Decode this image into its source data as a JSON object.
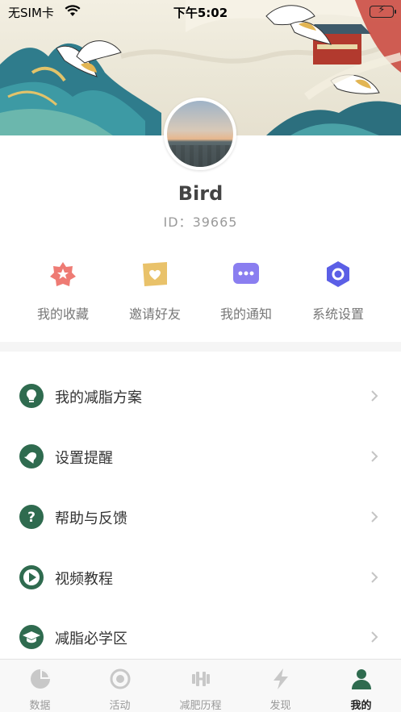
{
  "status_bar": {
    "carrier": "无SIM卡",
    "time": "下午5:02",
    "battery_icon": "battery-charging-icon",
    "wifi_icon": "wifi-icon"
  },
  "profile": {
    "name": "Bird",
    "id_label": "ID：",
    "id_value": "39665"
  },
  "quick_actions": [
    {
      "label": "我的收藏",
      "icon": "star-badge-icon",
      "color": "#ee7b74"
    },
    {
      "label": "邀请好友",
      "icon": "heart-note-icon",
      "color": "#e9c26a"
    },
    {
      "label": "我的通知",
      "icon": "message-dots-icon",
      "color": "#8a7ef0"
    },
    {
      "label": "系统设置",
      "icon": "hexagon-settings-icon",
      "color": "#5b5fe6"
    }
  ],
  "menu": [
    {
      "label": "我的减脂方案",
      "icon": "lightbulb-icon"
    },
    {
      "label": "设置提醒",
      "icon": "bell-icon"
    },
    {
      "label": "帮助与反馈",
      "icon": "help-icon"
    },
    {
      "label": "视频教程",
      "icon": "play-icon"
    },
    {
      "label": "减脂必学区",
      "icon": "graduation-cap-icon"
    }
  ],
  "tabs": [
    {
      "label": "数据",
      "icon": "pie-chart-icon",
      "active": false
    },
    {
      "label": "活动",
      "icon": "circle-target-icon",
      "active": false
    },
    {
      "label": "减肥历程",
      "icon": "dumbbell-icon",
      "active": false
    },
    {
      "label": "发现",
      "icon": "lightning-icon",
      "active": false
    },
    {
      "label": "我的",
      "icon": "person-icon",
      "active": true
    }
  ],
  "colors": {
    "accent_green": "#2f6b4f",
    "tab_inactive": "#c8c8c8",
    "tab_active": "#2f6b4f"
  }
}
